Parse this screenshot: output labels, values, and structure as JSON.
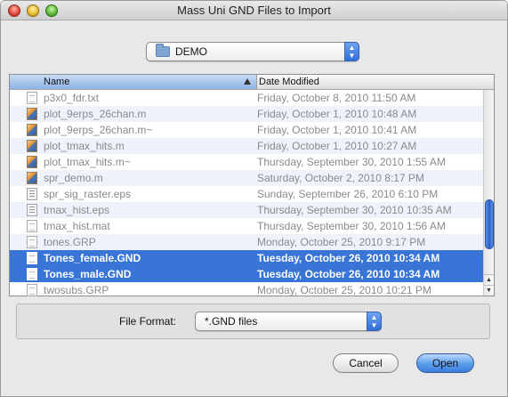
{
  "window": {
    "title": "Mass Uni GND Files to Import"
  },
  "location": {
    "selected": "DEMO"
  },
  "columns": {
    "name": "Name",
    "date": "Date Modified"
  },
  "files": [
    {
      "name": "p3x0_fdr.txt",
      "date": "Friday, October 8, 2010 11:50 AM",
      "icon": "document-icon",
      "selected": false
    },
    {
      "name": "plot_9erps_26chan.m",
      "date": "Friday, October 1, 2010 10:48 AM",
      "icon": "matlab-file-icon",
      "selected": false
    },
    {
      "name": "plot_9erps_26chan.m~",
      "date": "Friday, October 1, 2010 10:41 AM",
      "icon": "matlab-file-icon",
      "selected": false
    },
    {
      "name": "plot_tmax_hits.m",
      "date": "Friday, October 1, 2010 10:27 AM",
      "icon": "matlab-file-icon",
      "selected": false
    },
    {
      "name": "plot_tmax_hits.m~",
      "date": "Thursday, September 30, 2010 1:55 AM",
      "icon": "matlab-file-icon",
      "selected": false
    },
    {
      "name": "spr_demo.m",
      "date": "Saturday, October 2, 2010 8:17 PM",
      "icon": "matlab-file-icon",
      "selected": false
    },
    {
      "name": "spr_sig_raster.eps",
      "date": "Sunday, September 26, 2010 6:10 PM",
      "icon": "eps-file-icon",
      "selected": false
    },
    {
      "name": "tmax_hist.eps",
      "date": "Thursday, September 30, 2010 10:35 AM",
      "icon": "eps-file-icon",
      "selected": false
    },
    {
      "name": "tmax_hist.mat",
      "date": "Thursday, September 30, 2010 1:56 AM",
      "icon": "document-icon",
      "selected": false
    },
    {
      "name": "tones.GRP",
      "date": "Monday, October 25, 2010 9:17 PM",
      "icon": "document-icon",
      "selected": false
    },
    {
      "name": "Tones_female.GND",
      "date": "Tuesday, October 26, 2010 10:34 AM",
      "icon": "document-icon",
      "selected": true
    },
    {
      "name": "Tones_male.GND",
      "date": "Tuesday, October 26, 2010 10:34 AM",
      "icon": "document-icon",
      "selected": true
    },
    {
      "name": "twosubs.GRP",
      "date": "Monday, October 25, 2010 10:21 PM",
      "icon": "document-icon",
      "selected": false
    }
  ],
  "format": {
    "label": "File Format:",
    "selected": "*.GND files"
  },
  "buttons": {
    "cancel": "Cancel",
    "open": "Open"
  },
  "colors": {
    "selection": "#3875d7",
    "accent": "#2f6fd8"
  }
}
